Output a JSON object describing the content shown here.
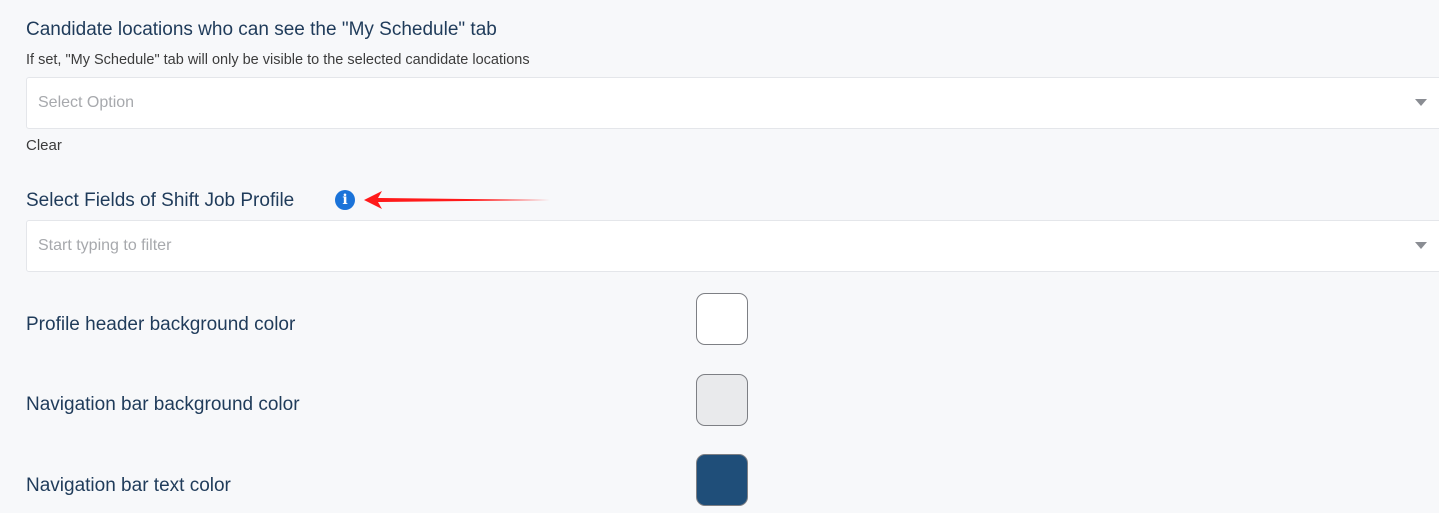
{
  "candidate_locations": {
    "title": "Candidate locations who can see the \"My Schedule\" tab",
    "description": "If set, \"My Schedule\" tab will only be visible to the selected candidate locations",
    "select_placeholder": "Select Option",
    "clear_label": "Clear"
  },
  "shift_job_profile": {
    "title": "Select Fields of Shift Job Profile",
    "info_icon_glyph": "i",
    "filter_placeholder": "Start typing to filter"
  },
  "annotation": {
    "arrow_color": "#ff1a1a"
  },
  "colors": [
    {
      "label": "Profile header background color",
      "value": "#ffffff"
    },
    {
      "label": "Navigation bar background color",
      "value": "#e9eaec"
    },
    {
      "label": "Navigation bar text color",
      "value": "#1f4e79"
    }
  ]
}
